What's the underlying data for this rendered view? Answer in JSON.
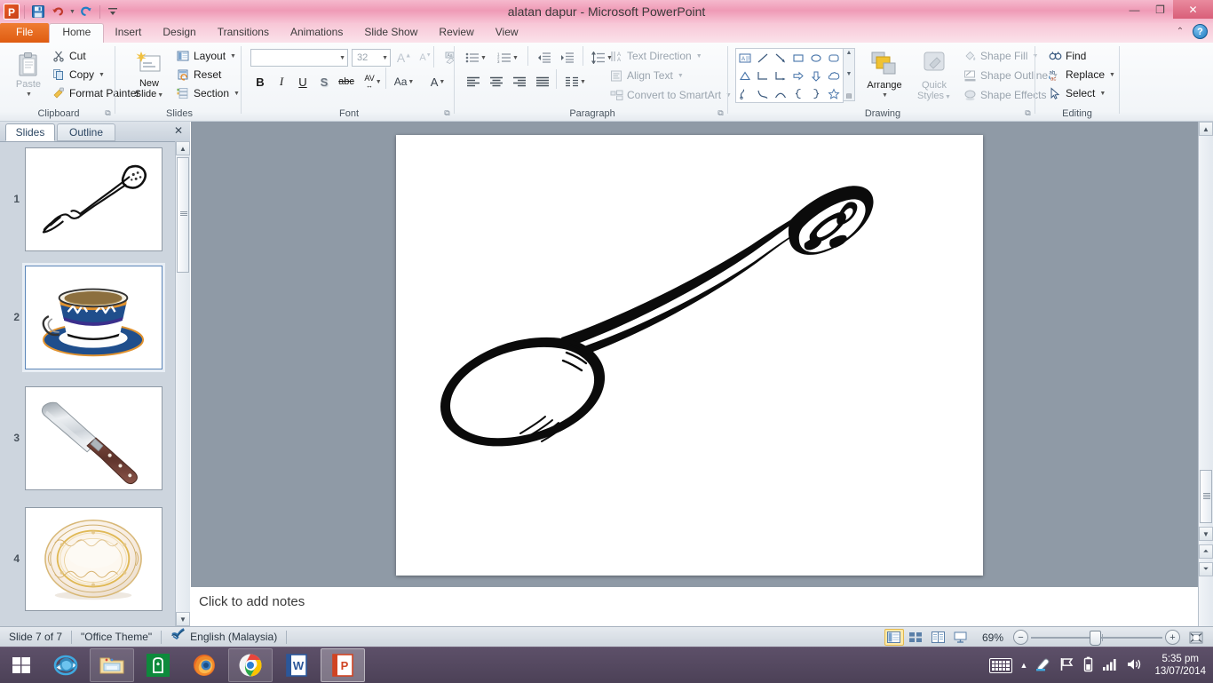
{
  "window": {
    "title": "alatan dapur - Microsoft PowerPoint",
    "minimize_label": "—",
    "restore_label": "❐",
    "close_label": "✕"
  },
  "quick_access": {
    "logo_label": "P",
    "items": [
      {
        "name": "save-button",
        "icon": "save-icon",
        "label": "Save"
      },
      {
        "name": "undo-button",
        "icon": "undo-icon",
        "label": "Undo"
      },
      {
        "name": "redo-button",
        "icon": "redo-icon",
        "label": "Redo"
      },
      {
        "name": "customize-qat-button",
        "icon": "customize-icon",
        "label": "Customize Quick Access Toolbar"
      }
    ]
  },
  "ribbon": {
    "tabs": [
      {
        "label": "File",
        "active": false,
        "file": true
      },
      {
        "label": "Home",
        "active": true
      },
      {
        "label": "Insert",
        "active": false
      },
      {
        "label": "Design",
        "active": false
      },
      {
        "label": "Transitions",
        "active": false
      },
      {
        "label": "Animations",
        "active": false
      },
      {
        "label": "Slide Show",
        "active": false
      },
      {
        "label": "Review",
        "active": false
      },
      {
        "label": "View",
        "active": false
      }
    ],
    "collapse_label": "⌃",
    "help_label": "?",
    "groups": {
      "clipboard": {
        "label": "Clipboard",
        "paste": "Paste",
        "cut": "Cut",
        "copy": "Copy",
        "format_painter": "Format Painter"
      },
      "slides": {
        "label": "Slides",
        "new_slide_line1": "New",
        "new_slide_line2": "Slide",
        "layout": "Layout",
        "reset": "Reset",
        "section": "Section"
      },
      "font": {
        "label": "Font",
        "font_name": "",
        "font_size": "32",
        "bold": "B",
        "italic": "I",
        "underline": "U",
        "shadow": "S",
        "strikethrough": "abc",
        "character_spacing": "AV",
        "change_case": "Aa",
        "font_color": "A",
        "grow_font": "A",
        "shrink_font": "A",
        "clear_formatting": "Clear All Formatting"
      },
      "paragraph": {
        "label": "Paragraph",
        "text_direction": "Text Direction",
        "align_text": "Align Text",
        "convert_to_smartart": "Convert to SmartArt"
      },
      "drawing": {
        "label": "Drawing",
        "arrange": "Arrange",
        "quick_styles_line1": "Quick",
        "quick_styles_line2": "Styles",
        "shape_fill": "Shape Fill",
        "shape_outline": "Shape Outline",
        "shape_effects": "Shape Effects",
        "shapes": [
          "textbox-shape",
          "line-shape",
          "arrow-shape",
          "rectangle-shape",
          "oval-shape",
          "rounded-rectangle-shape",
          "triangle-shape",
          "elbow-connector-shape",
          "elbow-arrow-connector-shape",
          "right-arrow-shape",
          "down-arrow-shape",
          "cloud-shape",
          "freeform-shape",
          "curve-shape",
          "arc-shape",
          "left-brace-shape",
          "right-brace-shape",
          "star-shape"
        ]
      },
      "editing": {
        "label": "Editing",
        "find": "Find",
        "replace": "Replace",
        "select": "Select"
      }
    }
  },
  "slides_pane": {
    "tab_slides": "Slides",
    "tab_outline": "Outline",
    "close_label": "✕",
    "thumbnails": [
      {
        "number": "1",
        "content": "fork-illustration",
        "selected": false
      },
      {
        "number": "2",
        "content": "teacup-and-saucer-illustration",
        "selected": true
      },
      {
        "number": "3",
        "content": "kitchen-knife-illustration",
        "selected": false
      },
      {
        "number": "4",
        "content": "decorative-plate-illustration",
        "selected": false
      }
    ]
  },
  "slide_canvas": {
    "content": "spoon-line-drawing",
    "background": "#ffffff"
  },
  "notes_pane": {
    "placeholder": "Click to add notes"
  },
  "status_bar": {
    "slide_counter": "Slide 7 of 7",
    "theme": "\"Office Theme\"",
    "language": "English (Malaysia)",
    "spellcheck_icon": "spellcheck-icon",
    "zoom_level": "69%",
    "zoom_out_label": "−",
    "zoom_in_label": "+",
    "view_buttons": [
      {
        "name": "view-normal",
        "label": "Normal",
        "active": true
      },
      {
        "name": "view-slide-sorter",
        "label": "Slide Sorter",
        "active": false
      },
      {
        "name": "view-reading",
        "label": "Reading View",
        "active": false
      },
      {
        "name": "view-slide-show",
        "label": "Slide Show",
        "active": false
      }
    ],
    "fit_slide_label": "Fit slide to current window"
  },
  "taskbar": {
    "start_label": "Start",
    "items": [
      {
        "name": "taskbar-internet-explorer",
        "label": "Internet Explorer",
        "state": "pinned"
      },
      {
        "name": "taskbar-file-explorer",
        "label": "File Explorer",
        "state": "open"
      },
      {
        "name": "taskbar-store",
        "label": "Store",
        "state": "pinned"
      },
      {
        "name": "taskbar-firefox",
        "label": "Mozilla Firefox",
        "state": "pinned"
      },
      {
        "name": "taskbar-chrome",
        "label": "Google Chrome",
        "state": "open"
      },
      {
        "name": "taskbar-word",
        "label": "Microsoft Word",
        "state": "pinned"
      },
      {
        "name": "taskbar-powerpoint",
        "label": "Microsoft PowerPoint",
        "state": "active"
      }
    ],
    "tray": {
      "keyboard_icon": "keyboard-icon",
      "show_hidden_label": "▲",
      "ink_icon": "ink-icon",
      "flag_icon": "flag-icon",
      "battery_icon": "battery-icon",
      "network_icon": "network-signal-icon",
      "volume_icon": "volume-icon",
      "time": "5:35 pm",
      "date": "13/07/2014"
    }
  },
  "colors": {
    "title_accent": "#ef9ab6",
    "file_tab": "#df5c11",
    "close_button": "#d95f79",
    "slide_area": "#8f9aa6",
    "taskbar": "#4c4157"
  }
}
